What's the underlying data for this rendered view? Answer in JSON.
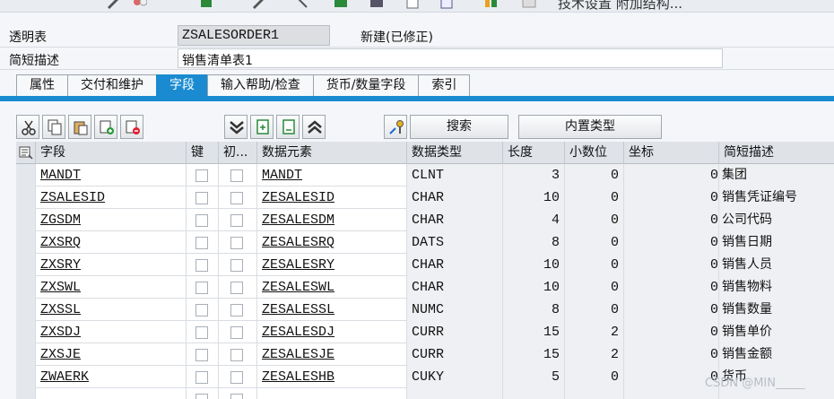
{
  "toolbar": {
    "partial_text": "技术设置    附加结构..."
  },
  "header": {
    "table_label": "透明表",
    "table_name": "ZSALESORDER1",
    "status": "新建(已修正)",
    "short_desc_label": "简短描述",
    "short_desc": "销售清单表1"
  },
  "tabs": [
    "属性",
    "交付和维护",
    "字段",
    "输入帮助/检查",
    "货币/数量字段",
    "索引"
  ],
  "active_tab": "字段",
  "grid_toolbar": {
    "search": "搜索",
    "builtin_type": "内置类型"
  },
  "columns": [
    "字段",
    "键",
    "初...",
    "数据元素",
    "数据类型",
    "长度",
    "小数位",
    "坐标",
    "简短描述"
  ],
  "rows": [
    {
      "field": "MANDT",
      "element": "MANDT",
      "type": "CLNT",
      "length": "3",
      "decimals": "0",
      "coord": "0",
      "desc": "集团"
    },
    {
      "field": "ZSALESID",
      "element": "ZESALESID",
      "type": "CHAR",
      "length": "10",
      "decimals": "0",
      "coord": "0",
      "desc": "销售凭证编号"
    },
    {
      "field": "ZGSDM",
      "element": "ZESALESDM",
      "type": "CHAR",
      "length": "4",
      "decimals": "0",
      "coord": "0",
      "desc": "公司代码"
    },
    {
      "field": "ZXSRQ",
      "element": "ZESALESRQ",
      "type": "DATS",
      "length": "8",
      "decimals": "0",
      "coord": "0",
      "desc": "销售日期"
    },
    {
      "field": "ZXSRY",
      "element": "ZESALESRY",
      "type": "CHAR",
      "length": "10",
      "decimals": "0",
      "coord": "0",
      "desc": "销售人员"
    },
    {
      "field": "ZXSWL",
      "element": "ZESALESWL",
      "type": "CHAR",
      "length": "10",
      "decimals": "0",
      "coord": "0",
      "desc": "销售物料"
    },
    {
      "field": "ZXSSL",
      "element": "ZESALESSL",
      "type": "NUMC",
      "length": "8",
      "decimals": "0",
      "coord": "0",
      "desc": "销售数量"
    },
    {
      "field": "ZXSDJ",
      "element": "ZESALESDJ",
      "type": "CURR",
      "length": "15",
      "decimals": "2",
      "coord": "0",
      "desc": "销售单价"
    },
    {
      "field": "ZXSJE",
      "element": "ZESALESJE",
      "type": "CURR",
      "length": "15",
      "decimals": "2",
      "coord": "0",
      "desc": "销售金额"
    },
    {
      "field": "ZWAERK",
      "element": "ZESALESHB",
      "type": "CUKY",
      "length": "5",
      "decimals": "0",
      "coord": "0",
      "desc": "货币"
    }
  ],
  "watermark": "CSDN @MIN_____"
}
